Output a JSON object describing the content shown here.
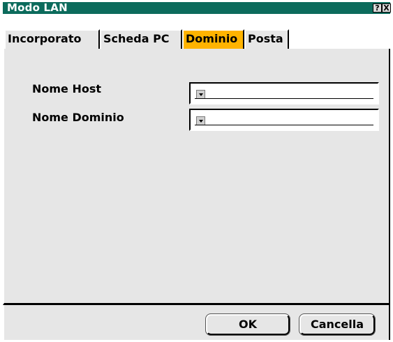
{
  "window": {
    "title": "Modo LAN",
    "help_label": "?",
    "close_label": "X"
  },
  "tabs": [
    {
      "label": "Incorporato",
      "selected": false
    },
    {
      "label": "Scheda PC",
      "selected": false
    },
    {
      "label": "Dominio",
      "selected": true
    },
    {
      "label": "Posta",
      "selected": false
    }
  ],
  "form": {
    "host": {
      "label": "Nome Host",
      "value": ""
    },
    "domain": {
      "label": "Nome Dominio",
      "value": ""
    }
  },
  "buttons": {
    "ok": "OK",
    "cancel": "Cancella"
  },
  "colors": {
    "title_bar": "#0c6b5c",
    "selected_tab": "#ffb300",
    "panel": "#e6e6e6"
  },
  "icons": {
    "help": "question-mark-icon",
    "close": "close-icon",
    "dropdown": "dropdown-arrow-icon"
  }
}
